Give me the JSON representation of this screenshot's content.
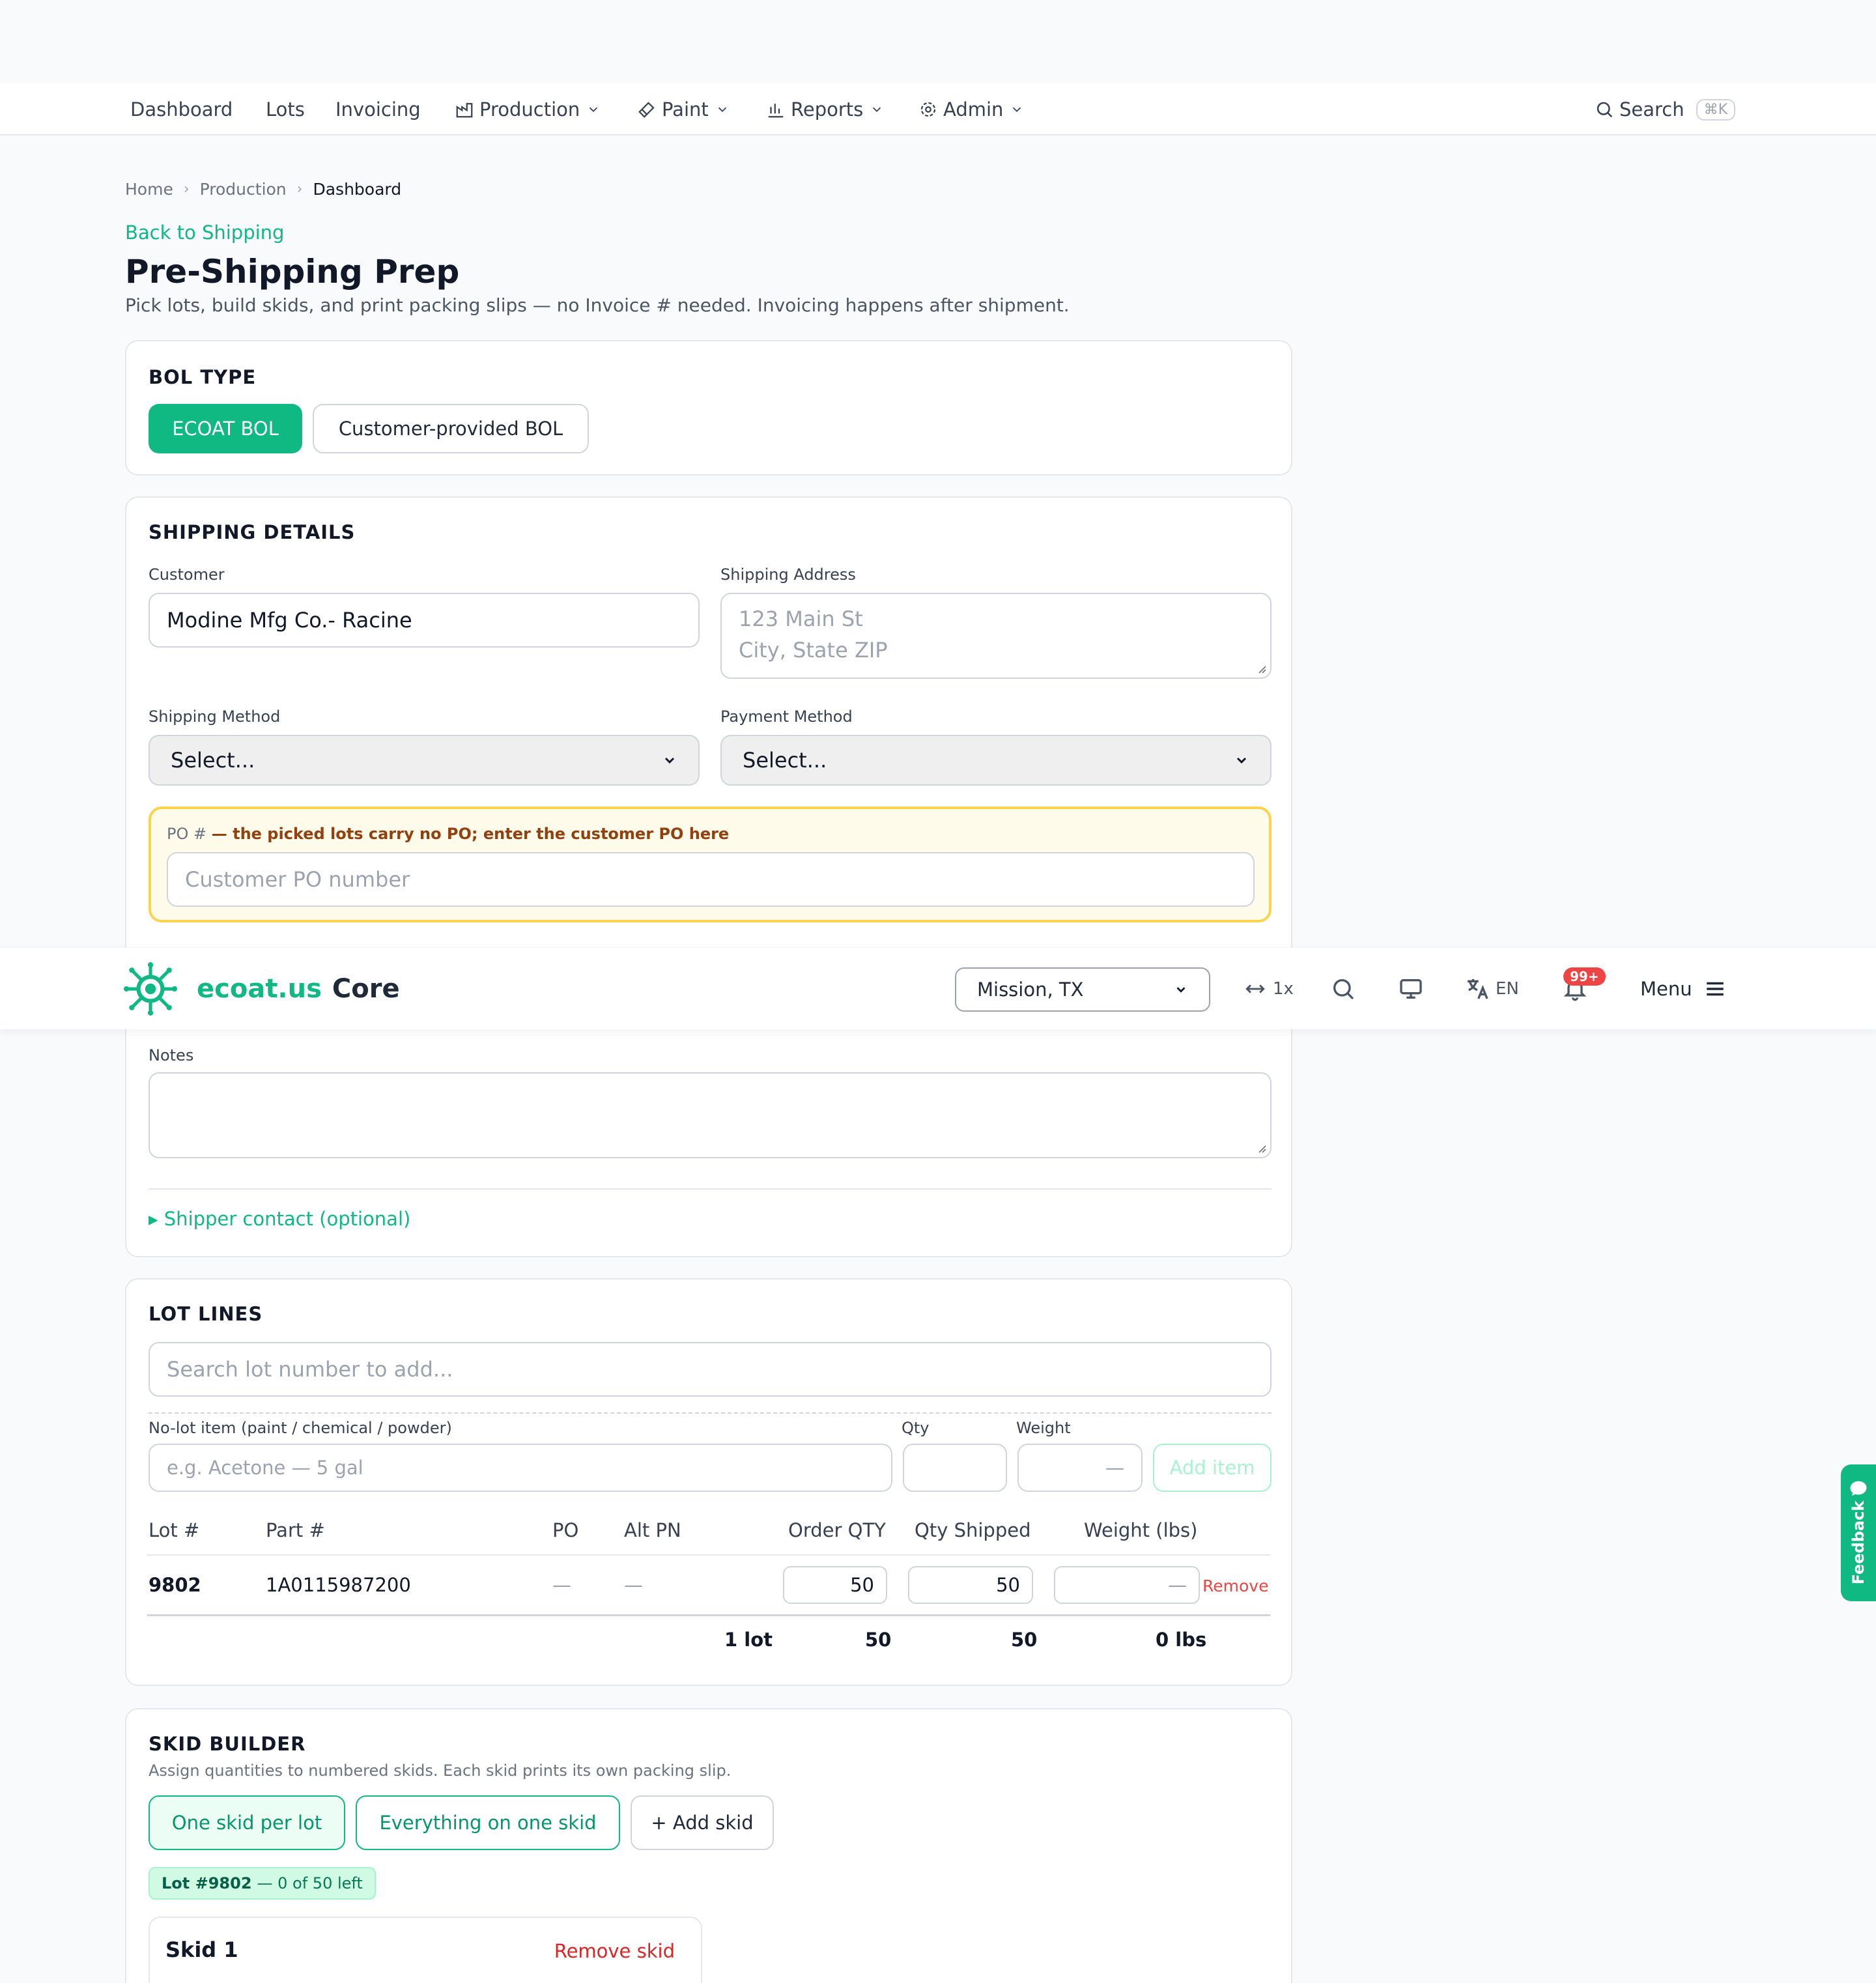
{
  "nav": {
    "items": [
      "Dashboard",
      "Lots",
      "Invoicing",
      "Production",
      "Paint",
      "Reports",
      "Admin"
    ],
    "search_label": "Search",
    "search_shortcut": "⌘K"
  },
  "breadcrumb": [
    "Home",
    "Production",
    "Dashboard"
  ],
  "back_link": "Back to Shipping",
  "page_title": "Pre-Shipping Prep",
  "page_subtitle": "Pick lots, build skids, and print packing slips — no Invoice # needed. Invoicing happens after shipment.",
  "bol_type": {
    "title": "BOL TYPE",
    "options": [
      "ECOAT BOL",
      "Customer-provided BOL"
    ],
    "selected": "ECOAT BOL"
  },
  "shipping": {
    "title": "SHIPPING DETAILS",
    "customer_label": "Customer",
    "customer_value": "Modine Mfg Co.- Racine",
    "address_label": "Shipping Address",
    "address_placeholder_line1": "123 Main St",
    "address_placeholder_line2": "City, State ZIP",
    "method_label": "Shipping Method",
    "method_value": "Select...",
    "payment_label": "Payment Method",
    "payment_value": "Select...",
    "po_label": "PO #",
    "po_note": "— the picked lots carry no PO; enter the customer PO here",
    "po_placeholder": "Customer PO number",
    "notes_label": "Notes",
    "shipper_toggle": "▸ Shipper contact (optional)"
  },
  "header": {
    "brand_primary": "ecoat.us",
    "brand_secondary": "Core",
    "location": "Mission, TX",
    "zoom": "1x",
    "language": "EN",
    "notifications": "99+",
    "menu_label": "Menu"
  },
  "lot_lines": {
    "title": "LOT LINES",
    "search_placeholder": "Search lot number to add...",
    "nolot_label": "No-lot item (paint / chemical / powder)",
    "nolot_placeholder": "e.g. Acetone — 5 gal",
    "qty_label": "Qty",
    "weight_label": "Weight",
    "weight_placeholder": "—",
    "add_item_label": "Add item",
    "columns": [
      "Lot #",
      "Part #",
      "PO",
      "Alt PN",
      "Order QTY",
      "Qty Shipped",
      "Weight (lbs)"
    ],
    "rows": [
      {
        "lot": "9802",
        "part": "1A0115987200",
        "po": "—",
        "alt_pn": "—",
        "order_qty": "50",
        "qty_shipped": "50",
        "weight": "—",
        "remove": "Remove"
      }
    ],
    "totals": {
      "lots": "1 lot",
      "order_qty": "50",
      "qty_shipped": "50",
      "weight": "0 lbs"
    }
  },
  "skid_builder": {
    "title": "SKID BUILDER",
    "subtitle": "Assign quantities to numbered skids. Each skid prints its own packing slip.",
    "buttons": [
      "One skid per lot",
      "Everything on one skid",
      "+ Add skid"
    ],
    "lot_chip_lot": "Lot #9802",
    "lot_chip_rest": "— 0 of 50 left",
    "skid_title": "Skid 1",
    "remove_skid": "Remove skid"
  },
  "feedback_label": "Feedback",
  "colors": {
    "accent": "#10b981",
    "danger": "#ef4444",
    "warning_bg": "#fffbeb",
    "warning_border": "#fcd34d"
  }
}
